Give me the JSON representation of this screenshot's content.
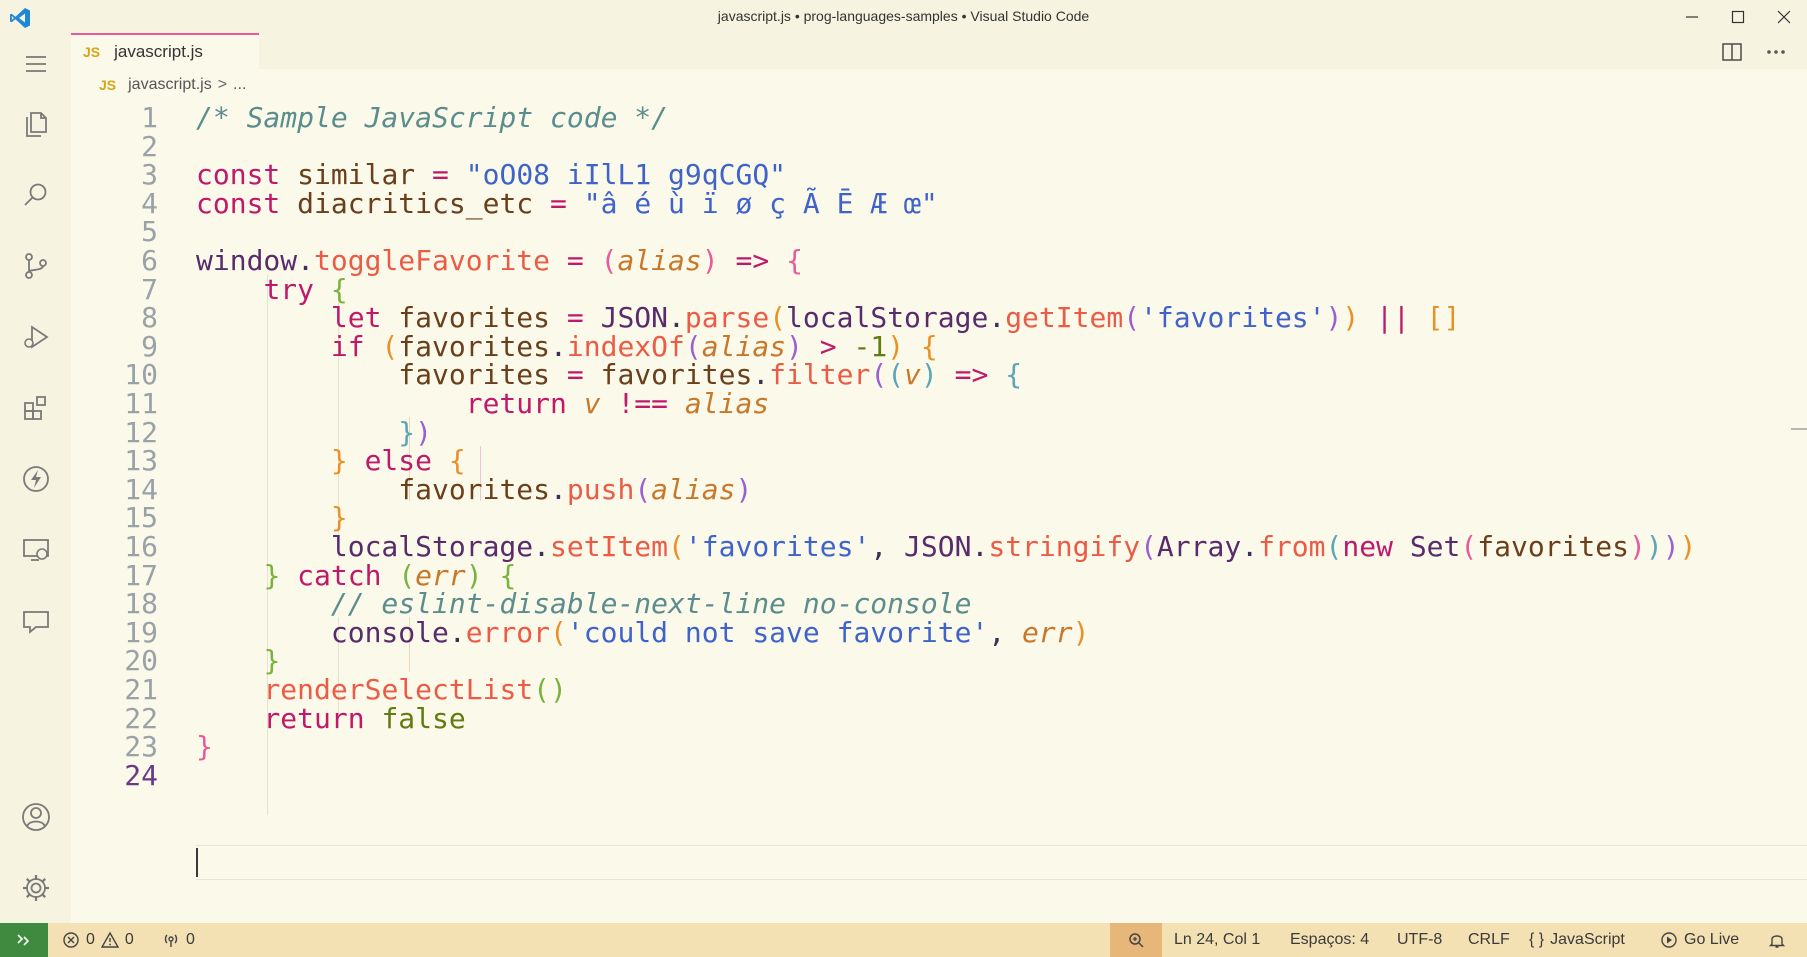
{
  "window": {
    "title": "javascript.js • prog-languages-samples • Visual Studio Code"
  },
  "activity_bar": {
    "items": [
      "explorer-icon",
      "search-icon",
      "source-control-icon",
      "run-debug-icon",
      "extensions-icon",
      "thunder-icon",
      "remote-explorer-icon",
      "comments-icon"
    ],
    "bottom": [
      "account-icon",
      "gear-icon"
    ]
  },
  "tabs": [
    {
      "badge": "JS",
      "label": "javascript.js",
      "active": true
    }
  ],
  "breadcrumb": {
    "badge": "JS",
    "file": "javascript.js",
    "separator": ">",
    "more": "..."
  },
  "editor": {
    "active_line": 24,
    "line_numbers": [
      "1",
      "2",
      "3",
      "4",
      "5",
      "6",
      "7",
      "8",
      "9",
      "10",
      "11",
      "12",
      "13",
      "14",
      "15",
      "16",
      "17",
      "18",
      "19",
      "20",
      "21",
      "22",
      "23",
      "24"
    ],
    "code_lines": [
      "/* Sample JavaScript code */",
      "",
      "const similar = \"oO08 iIlL1 g9qCGQ\"",
      "const diacritics_etc = \"â é ù ï ø ç Ã Ē Æ œ\"",
      "",
      "window.toggleFavorite = (alias) => {",
      "    try {",
      "        let favorites = JSON.parse(localStorage.getItem('favorites')) || []",
      "        if (favorites.indexOf(alias) > -1) {",
      "            favorites = favorites.filter((v) => {",
      "                return v !== alias",
      "            })",
      "        } else {",
      "            favorites.push(alias)",
      "        }",
      "        localStorage.setItem('favorites', JSON.stringify(Array.from(new Set(favorites))))",
      "    } catch (err) {",
      "        // eslint-disable-next-line no-console",
      "        console.error('could not save favorite', err)",
      "    }",
      "    renderSelectList()",
      "    return false",
      "}",
      ""
    ]
  },
  "status_bar": {
    "errors": "0",
    "warnings": "0",
    "ports": "0",
    "position": "Ln 24, Col 1",
    "indent": "Espaços: 4",
    "encoding": "UTF-8",
    "eol": "CRLF",
    "language_icon": "{ }",
    "language": "JavaScript",
    "live": "Go Live"
  },
  "colors": {
    "background": "#fbf9ea",
    "chrome": "#f6f3e0",
    "status_bar": "#f3e1b4",
    "remote": "#3f8a3f",
    "accent": "#e75a9b"
  }
}
